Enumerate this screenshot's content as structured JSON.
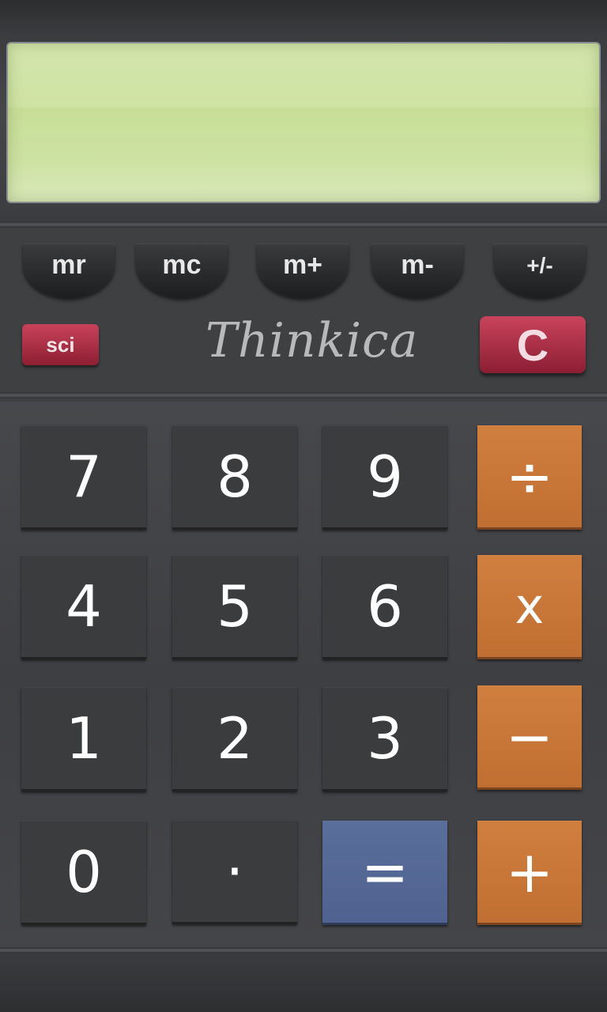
{
  "display": {
    "value": ""
  },
  "memory_buttons": [
    {
      "label": "mr"
    },
    {
      "label": "mc"
    },
    {
      "label": "m+"
    },
    {
      "label": "m-"
    },
    {
      "label": "+/-"
    }
  ],
  "sci_label": "sci",
  "brand": "Thinkica",
  "clear_label": "C",
  "keys": {
    "seven": "7",
    "eight": "8",
    "nine": "9",
    "divide": "÷",
    "four": "4",
    "five": "5",
    "six": "6",
    "multiply": "x",
    "one": "1",
    "two": "2",
    "three": "3",
    "subtract": "−",
    "zero": "0",
    "decimal": "·",
    "equals": "=",
    "add": "+"
  },
  "colors": {
    "lcd": "#cfe3a4",
    "operator": "#c8773a",
    "equals": "#55689a",
    "clear": "#b0304a",
    "body": "#3f4042"
  }
}
